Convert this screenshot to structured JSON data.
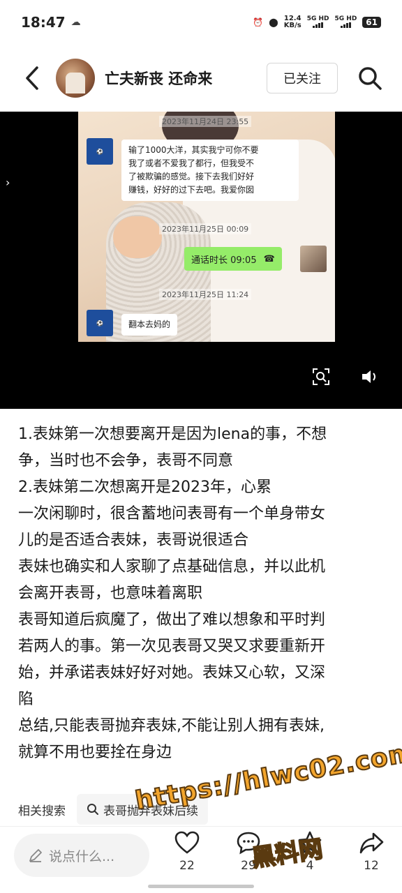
{
  "status_bar": {
    "time": "18:47",
    "net_speed_value": "12.4",
    "net_speed_unit": "KB/s",
    "signal_1": "5G HD",
    "signal_2": "5G HD",
    "battery": "61"
  },
  "header": {
    "username": "亡夫新丧 还命来",
    "follow_label": "已关注"
  },
  "chat_image": {
    "timestamp_1": "2023年11月24日 23:55",
    "message_1_lines": [
      "输了1000大洋，其实我宁可你不要",
      "我了或者不爱我了都行，但我受不",
      "了被欺骗的感觉。接下去我们好好",
      "赚钱，好好的过下去吧。我爱你囡"
    ],
    "timestamp_2": "2023年11月25日 00:09",
    "call_label": "通话时长 09:05",
    "timestamp_3": "2023年11月25日 11:24",
    "message_2": "翻本去妈的"
  },
  "post": {
    "lines": [
      "1.表妹第一次想要离开是因为lena的事，不想",
      "争，当时也不会争，表哥不同意",
      "2.表妹第二次想离开是2023年，心累",
      "一次闲聊时，很含蓄地问表哥有一个单身带女",
      "儿的是否适合表妹，表哥说很适合",
      "表妹也确实和人家聊了点基础信息，并以此机",
      "会离开表哥，也意味着离职",
      "表哥知道后疯魔了，做出了难以想象和平时判",
      "若两人的事。第一次见表哥又哭又求要重新开",
      "始，并承诺表妹好好对她。表妹又心软，又深",
      "陷",
      "总结,只能表哥抛弃表妹,不能让别人拥有表妹,",
      "就算不用也要拴在身边"
    ]
  },
  "related": {
    "label": "相关搜索",
    "query": "表哥抛弃表妹后续"
  },
  "bottom_bar": {
    "comment_placeholder": "说点什么...",
    "like_count": "22",
    "comment_count": "29",
    "collect_count": "4",
    "share_count": "12"
  },
  "watermark": {
    "url": "https://hlwc02.com",
    "name": "黑料网"
  },
  "colors": {
    "accent_green": "#95ec69",
    "watermark_orange": "#f3a52c"
  }
}
